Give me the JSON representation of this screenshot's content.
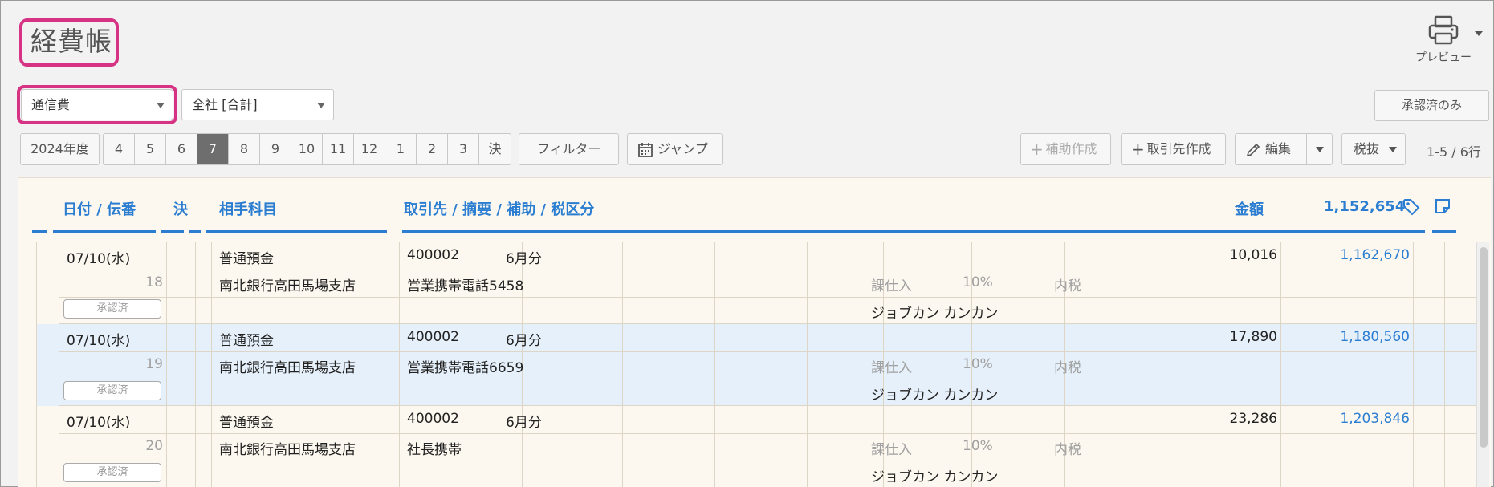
{
  "header": {
    "title": "経費帳",
    "preview_label": "プレビュー"
  },
  "filters": {
    "account": "通信費",
    "company": "全社 [合計]",
    "approved_only": "承認済のみ"
  },
  "toolbar": {
    "fiscal_year": "2024年度",
    "months": [
      "4",
      "5",
      "6",
      "7",
      "8",
      "9",
      "10",
      "11",
      "12",
      "1",
      "2",
      "3",
      "決"
    ],
    "active_month": "7",
    "filter_label": "フィルター",
    "jump_label": "ジャンプ",
    "add_aux_label": "補助作成",
    "add_partner_label": "取引先作成",
    "edit_label": "編集",
    "tax_mode": "税抜",
    "count": "1-5 / 6行"
  },
  "columns": {
    "date": "日付 / 伝番",
    "settle": "決",
    "counter_account": "相手科目",
    "partner": "取引先 / 摘要 / 補助 / 税区分",
    "amount": "金額",
    "balance_header": "1,152,654"
  },
  "rows": [
    {
      "date": "07/10(水)",
      "number": "18",
      "status": "承認済",
      "account": "普通預金",
      "sub_account": "南北銀行高田馬場支店",
      "partner_code": "400002",
      "memo1": "6月分",
      "memo2": "営業携帯電話5458",
      "tax_class": "課仕入",
      "tax_rate": "10%",
      "tax_type": "内税",
      "person": "ジョブカン カンカン",
      "amount": "10,016",
      "balance": "1,162,670"
    },
    {
      "date": "07/10(水)",
      "number": "19",
      "status": "承認済",
      "account": "普通預金",
      "sub_account": "南北銀行高田馬場支店",
      "partner_code": "400002",
      "memo1": "6月分",
      "memo2": "営業携帯電話6659",
      "tax_class": "課仕入",
      "tax_rate": "10%",
      "tax_type": "内税",
      "person": "ジョブカン カンカン",
      "amount": "17,890",
      "balance": "1,180,560"
    },
    {
      "date": "07/10(水)",
      "number": "20",
      "status": "承認済",
      "account": "普通預金",
      "sub_account": "南北銀行高田馬場支店",
      "partner_code": "400002",
      "memo1": "6月分",
      "memo2": "社長携帯",
      "tax_class": "課仕入",
      "tax_rate": "10%",
      "tax_type": "内税",
      "person": "ジョブカン カンカン",
      "amount": "23,286",
      "balance": "1,203,846"
    }
  ],
  "colors": {
    "accent": "#2a7dd1",
    "highlight_border": "#d63384",
    "selected_row": "#e6f0fb"
  }
}
